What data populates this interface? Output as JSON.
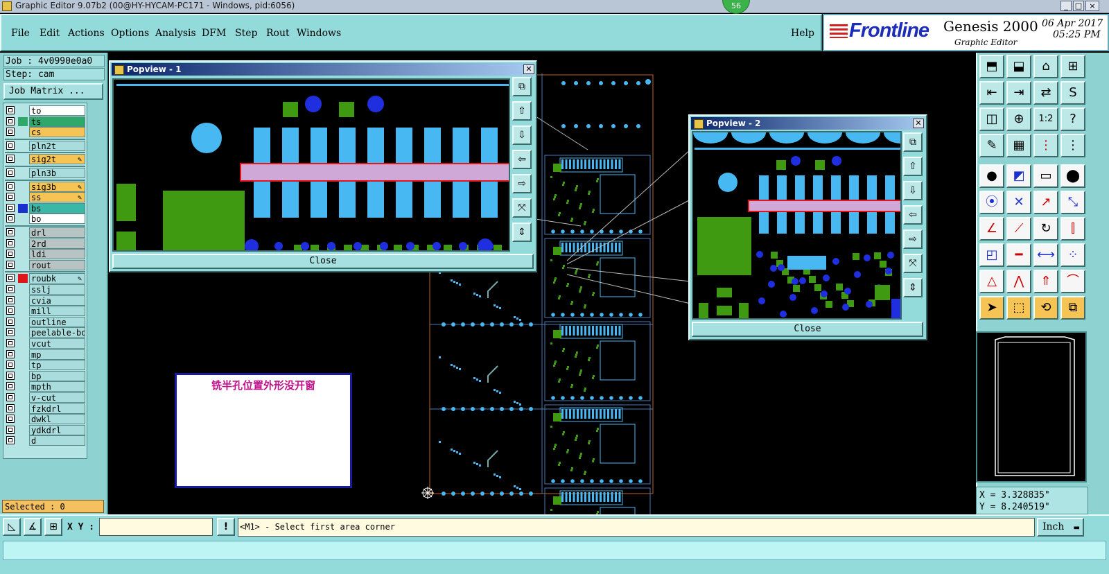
{
  "window": {
    "title": "Graphic Editor 9.07b2 (00@HY-HYCAM-PC171 - Windows, pid:6056)",
    "badge": "56",
    "controls": [
      "_",
      "□",
      "×"
    ]
  },
  "menu": {
    "items": [
      "File",
      "Edit",
      "Actions",
      "Options",
      "Analysis",
      "DFM",
      "Step",
      "Rout",
      "Windows"
    ],
    "help": "Help"
  },
  "brand": {
    "logo": "Frontline",
    "product": "Genesis 2000",
    "subtitle": "Graphic Editor",
    "date": "06 Apr 2017",
    "time": "05:25 PM"
  },
  "job": {
    "job_label": "Job : 4v0990e0a0",
    "step_label": "Step: cam",
    "matrix_button": "Job Matrix ..."
  },
  "layers": [
    {
      "name": "to",
      "style": "white",
      "swatch": ""
    },
    {
      "name": "ts",
      "style": "green",
      "swatch": "#2fa86a"
    },
    {
      "name": "cs",
      "style": "orange",
      "swatch": ""
    },
    {
      "name": "pln2t",
      "style": "plain",
      "swatch": ""
    },
    {
      "name": "sig2t",
      "style": "orange",
      "swatch": "",
      "lock": true
    },
    {
      "name": "pln3b",
      "style": "plain",
      "swatch": ""
    },
    {
      "name": "sig3b",
      "style": "orange",
      "swatch": "",
      "lock": true
    },
    {
      "name": "ss",
      "style": "orange",
      "swatch": "",
      "lock": true
    },
    {
      "name": "bs",
      "style": "aqua",
      "swatch": "#1a2fd0"
    },
    {
      "name": "bo",
      "style": "white",
      "swatch": ""
    },
    {
      "name": "drl",
      "style": "gray",
      "swatch": ""
    },
    {
      "name": "2rd",
      "style": "gray",
      "swatch": ""
    },
    {
      "name": "ldi",
      "style": "gray",
      "swatch": ""
    },
    {
      "name": "rout",
      "style": "gray",
      "swatch": ""
    },
    {
      "name": "roubk",
      "style": "plain",
      "swatch": "#e0151a",
      "lock": true
    },
    {
      "name": "sslj",
      "style": "plain",
      "swatch": ""
    },
    {
      "name": "cvia",
      "style": "plain",
      "swatch": ""
    },
    {
      "name": "mill",
      "style": "plain",
      "swatch": ""
    },
    {
      "name": "outline",
      "style": "plain",
      "swatch": ""
    },
    {
      "name": "peelable-bot",
      "style": "plain",
      "swatch": ""
    },
    {
      "name": "vcut",
      "style": "plain",
      "swatch": ""
    },
    {
      "name": "mp",
      "style": "plain",
      "swatch": ""
    },
    {
      "name": "tp",
      "style": "plain",
      "swatch": ""
    },
    {
      "name": "bp",
      "style": "plain",
      "swatch": ""
    },
    {
      "name": "mpth",
      "style": "plain",
      "swatch": ""
    },
    {
      "name": "v-cut",
      "style": "plain",
      "swatch": ""
    },
    {
      "name": "fzkdrl",
      "style": "plain",
      "swatch": ""
    },
    {
      "name": "dwkl",
      "style": "plain",
      "swatch": ""
    },
    {
      "name": "ydkdrl",
      "style": "plain",
      "swatch": ""
    },
    {
      "name": "d",
      "style": "plain",
      "swatch": ""
    }
  ],
  "selected": "Selected : 0",
  "popview1": {
    "title": "Popview - 1",
    "close": "Close"
  },
  "popview2": {
    "title": "Popview - 2",
    "close": "Close"
  },
  "note": {
    "text": "铣半孔位置外形没开窗"
  },
  "coords": {
    "x": "X = 3.328835\"",
    "y": "Y = 8.240519\""
  },
  "bottom": {
    "xy_label": "X Y :",
    "xy_value": "",
    "status": "<M1> - Select first area corner",
    "units": "Inch",
    "info_button": "!"
  },
  "colors": {
    "ui_teal": "#93dada",
    "pad_blue": "#47b8f2",
    "copper_green": "#3f9a12",
    "via_blue": "#1f2fe0",
    "trace_red": "#e0151a",
    "note_border": "#1a1aa0",
    "note_text": "#c0108a"
  }
}
